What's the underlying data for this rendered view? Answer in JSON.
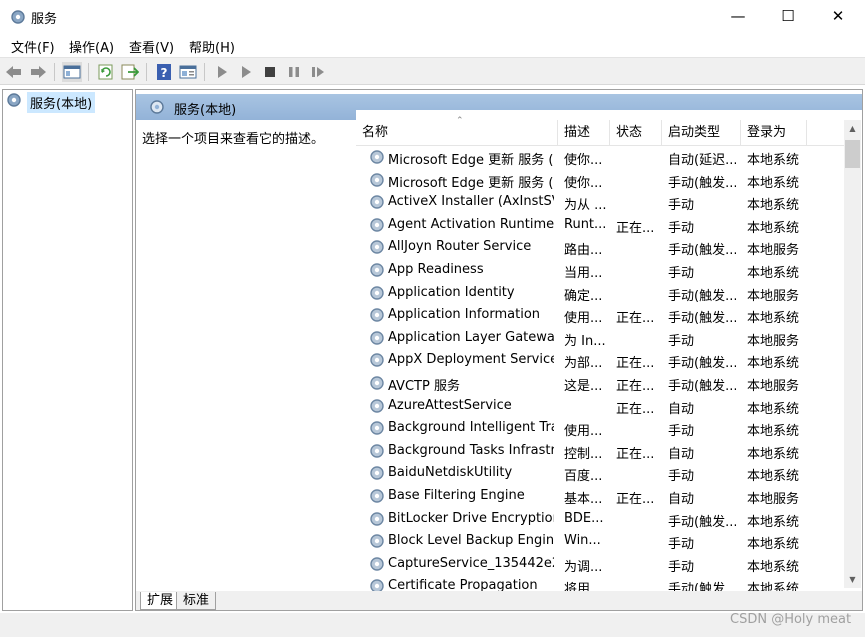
{
  "window": {
    "title": "服务",
    "min_glyph": "—",
    "max_glyph": "☐",
    "close_glyph": "✕"
  },
  "menu": [
    "文件(F)",
    "操作(A)",
    "查看(V)",
    "帮助(H)"
  ],
  "toolbar_icons": [
    "back-icon",
    "forward-icon",
    "console-tree-icon",
    "refresh-icon",
    "export-list-icon",
    "help-icon",
    "properties-icon",
    "start-service-icon",
    "start-alt-icon",
    "stop-service-icon",
    "pause-service-icon",
    "resume-service-icon"
  ],
  "tree": {
    "root_label": "服务(本地)"
  },
  "panel": {
    "header": "服务(本地)",
    "description": "选择一个项目来查看它的描述。"
  },
  "columns": [
    "名称",
    "描述",
    "状态",
    "启动类型",
    "登录为"
  ],
  "services": [
    {
      "name": "Microsoft Edge 更新 服务 (...",
      "desc": "使你...",
      "status": "",
      "startup": "自动(延迟...",
      "logon": "本地系统"
    },
    {
      "name": "Microsoft Edge 更新 服务 (...",
      "desc": "使你...",
      "status": "",
      "startup": "手动(触发...",
      "logon": "本地系统"
    },
    {
      "name": "ActiveX Installer (AxInstSV)",
      "desc": "为从 ...",
      "status": "",
      "startup": "手动",
      "logon": "本地系统"
    },
    {
      "name": "Agent Activation Runtime_...",
      "desc": "Runt...",
      "status": "正在...",
      "startup": "手动",
      "logon": "本地系统"
    },
    {
      "name": "AllJoyn Router Service",
      "desc": "路由...",
      "status": "",
      "startup": "手动(触发...",
      "logon": "本地服务"
    },
    {
      "name": "App Readiness",
      "desc": "当用...",
      "status": "",
      "startup": "手动",
      "logon": "本地系统"
    },
    {
      "name": "Application Identity",
      "desc": "确定...",
      "status": "",
      "startup": "手动(触发...",
      "logon": "本地服务"
    },
    {
      "name": "Application Information",
      "desc": "使用...",
      "status": "正在...",
      "startup": "手动(触发...",
      "logon": "本地系统"
    },
    {
      "name": "Application Layer Gateway ...",
      "desc": "为 In...",
      "status": "",
      "startup": "手动",
      "logon": "本地服务"
    },
    {
      "name": "AppX Deployment Service ...",
      "desc": "为部...",
      "status": "正在...",
      "startup": "手动(触发...",
      "logon": "本地系统"
    },
    {
      "name": "AVCTP 服务",
      "desc": "这是...",
      "status": "正在...",
      "startup": "手动(触发...",
      "logon": "本地服务"
    },
    {
      "name": "AzureAttestService",
      "desc": "",
      "status": "正在...",
      "startup": "自动",
      "logon": "本地系统"
    },
    {
      "name": "Background Intelligent Tra...",
      "desc": "使用...",
      "status": "",
      "startup": "手动",
      "logon": "本地系统"
    },
    {
      "name": "Background Tasks Infrastru...",
      "desc": "控制...",
      "status": "正在...",
      "startup": "自动",
      "logon": "本地系统"
    },
    {
      "name": "BaiduNetdiskUtility",
      "desc": "百度...",
      "status": "",
      "startup": "手动",
      "logon": "本地系统"
    },
    {
      "name": "Base Filtering Engine",
      "desc": "基本...",
      "status": "正在...",
      "startup": "自动",
      "logon": "本地服务"
    },
    {
      "name": "BitLocker Drive Encryption ...",
      "desc": "BDE...",
      "status": "",
      "startup": "手动(触发...",
      "logon": "本地系统"
    },
    {
      "name": "Block Level Backup Engine ...",
      "desc": "Win...",
      "status": "",
      "startup": "手动",
      "logon": "本地系统"
    },
    {
      "name": "CaptureService_135442e2",
      "desc": "为调...",
      "status": "",
      "startup": "手动",
      "logon": "本地系统"
    },
    {
      "name": "Certificate Propagation",
      "desc": "将用...",
      "status": "",
      "startup": "手动(触发...",
      "logon": "本地系统"
    }
  ],
  "tabs": [
    "扩展",
    "标准"
  ],
  "watermark": "CSDN @Holy meat",
  "colors": {
    "header_band": "#a8c4e2",
    "selection": "#cce8ff"
  }
}
